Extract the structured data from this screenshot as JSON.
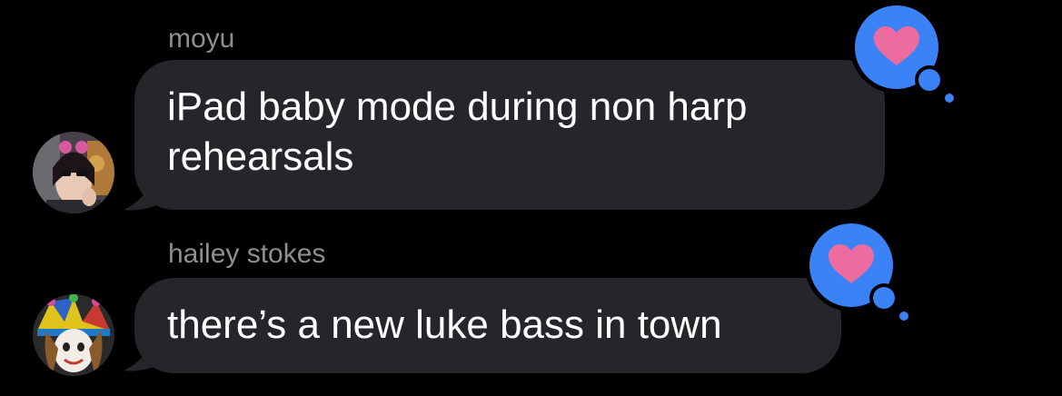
{
  "conversation": {
    "messages": [
      {
        "sender": "moyu",
        "lines": [
          "iPad baby mode during non harp",
          "rehearsals"
        ],
        "avatar": "moyu-avatar-photo",
        "tapback": "heart-icon"
      },
      {
        "sender": "hailey stokes",
        "lines": [
          "there’s a new luke bass in town"
        ],
        "avatar": "hailey-avatar-photo",
        "tapback": "heart-icon"
      }
    ]
  },
  "colors": {
    "background": "#000000",
    "bubble": "#26252a",
    "sender_text": "#8e8e93",
    "message_text": "#ffffff",
    "tapback_bubble": "#3b82f6",
    "heart": "#ec6ca0"
  }
}
